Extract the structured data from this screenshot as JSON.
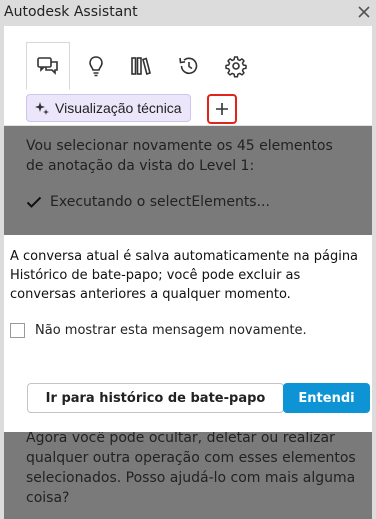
{
  "window": {
    "title": "Autodesk Assistant",
    "close_icon": "close-icon"
  },
  "tabs": [
    {
      "icon": "chat-icon",
      "active": true
    },
    {
      "icon": "lightbulb-icon",
      "active": false
    },
    {
      "icon": "library-icon",
      "active": false
    },
    {
      "icon": "history-icon",
      "active": false
    },
    {
      "icon": "gear-icon",
      "active": false
    }
  ],
  "chip": {
    "label": "Visualização técnica",
    "icon": "sparkle-icon"
  },
  "new_button": {
    "icon": "plus-icon",
    "highlight_color": "#e2231a"
  },
  "chat": {
    "message_1": "Vou selecionar novamente os 45 elementos de anotação da vista do Level 1:",
    "status": "Executando o selectElements...",
    "message_2": "Agora você pode ocultar, deletar ou realizar qualquer outra operação com esses elementos selecionados. Posso ajudá-lo com mais alguma coisa?"
  },
  "dialog": {
    "text": "A conversa atual é salva automaticamente na página Histórico de bate-papo; você pode excluir as conversas anteriores a qualquer momento.",
    "checkbox_label": "Não mostrar esta mensagem novamente.",
    "checkbox_checked": false,
    "secondary_button": "Ir para histórico de bate-papo",
    "primary_button": "Entendi",
    "primary_color": "#0e94d5"
  }
}
